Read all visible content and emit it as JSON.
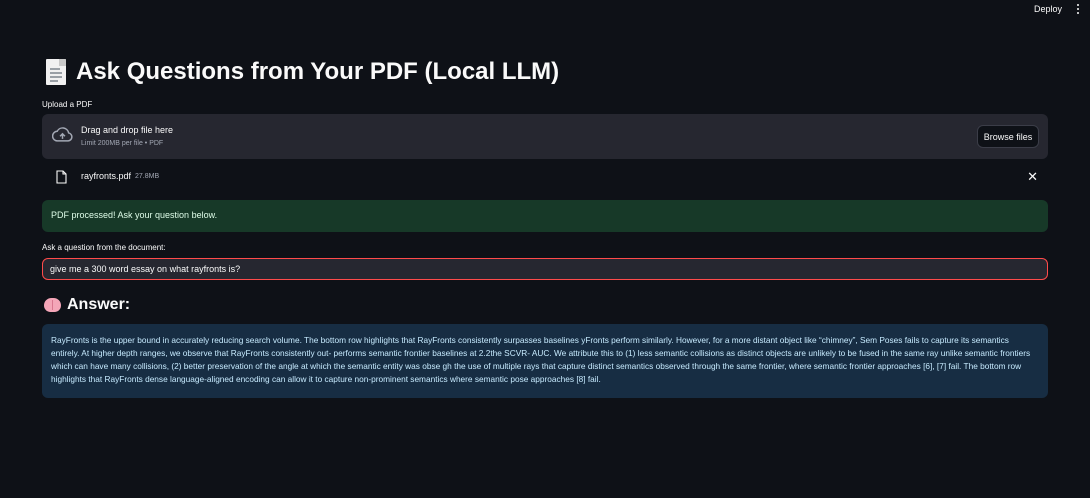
{
  "toolbar": {
    "deploy_label": "Deploy",
    "menu_icon": "vertical-dots-icon"
  },
  "page": {
    "title_icon": "document-icon",
    "title": "Ask Questions from Your PDF (Local LLM)"
  },
  "uploader": {
    "label": "Upload a PDF",
    "dropzone_icon": "cloud-upload-icon",
    "dropzone_title": "Drag and drop file here",
    "dropzone_sub": "Limit 200MB per file • PDF",
    "browse_label": "Browse files"
  },
  "uploaded_file": {
    "icon": "file-icon",
    "name": "rayfronts.pdf",
    "size": "27.8MB",
    "remove_icon": "close-icon"
  },
  "status": {
    "message": "PDF processed! Ask your question below.",
    "color": "#173928"
  },
  "question": {
    "label": "Ask a question from the document:",
    "value": "give me a 300 word essay on what rayfronts is?",
    "focus_color": "#ff4b4b"
  },
  "answer": {
    "icon": "brain-icon",
    "heading": "Answer:",
    "text": "RayFronts is the upper bound in accurately reducing search volume. The bottom row highlights that RayFronts consistently surpasses baselines yFronts perform similarly. However, for a more distant object like “chimney”, Sem Poses fails to capture its semantics entirely. At higher depth ranges, we observe that RayFronts consistently out- performs semantic frontier baselines at 2.2the SCVR- AUC. We attribute this to (1) less semantic collisions as distinct objects are unlikely to be fused in the same ray unlike semantic frontiers which can have many collisions, (2) better preservation of the angle at which the semantic entity was obse gh the use of multiple rays that capture distinct semantics observed through the same frontier, where semantic frontier approaches [6], [7] fail. The bottom row highlights that RayFronts dense language-aligned encoding can allow it to capture non-prominent semantics where semantic pose approaches [8] fail.",
    "box_color": "#172d43"
  }
}
